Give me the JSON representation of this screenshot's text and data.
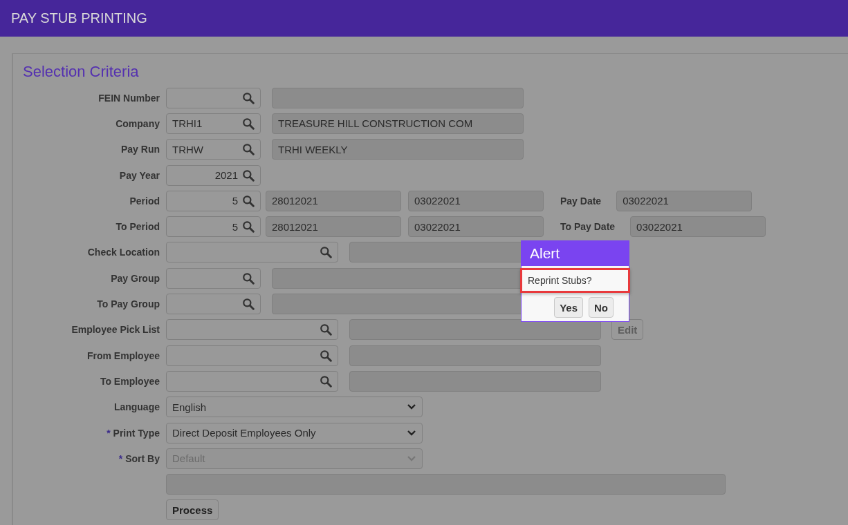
{
  "header": {
    "title": "PAY STUB PRINTING"
  },
  "section_title": "Selection Criteria",
  "rows": [
    {
      "kind": "lookup",
      "label": "FEIN Number"
    },
    {
      "kind": "lookup",
      "label": "Company",
      "value": "TRHI1",
      "description": "TREASURE HILL CONSTRUCTION COM"
    },
    {
      "kind": "lookup",
      "label": "Pay Run",
      "value": "TRHW",
      "description": "TRHI WEEKLY"
    },
    {
      "kind": "year",
      "label": "Pay Year",
      "value": "2021"
    },
    {
      "kind": "period",
      "label": "Period",
      "value": "5",
      "start": "28012021",
      "end": "03022021",
      "date_label": "Pay Date",
      "date": "03022021"
    },
    {
      "kind": "period",
      "label": "To Period",
      "value": "5",
      "start": "28012021",
      "end": "03022021",
      "date_label": "To Pay Date",
      "date": "03022021"
    },
    {
      "kind": "wide-lookup",
      "label": "Check Location"
    },
    {
      "kind": "lookup",
      "label": "Pay Group"
    },
    {
      "kind": "lookup",
      "label": "To Pay Group"
    },
    {
      "kind": "wide-lookup",
      "label": "Employee Pick List",
      "button": {
        "label": "Edit",
        "disabled": true
      }
    },
    {
      "kind": "wide-lookup",
      "label": "From Employee"
    },
    {
      "kind": "wide-lookup",
      "label": "To Employee"
    },
    {
      "kind": "select",
      "label": "Language",
      "value": "English",
      "disabled": false
    },
    {
      "kind": "select",
      "label": "Print Type",
      "required_mark": "*",
      "value": "Direct Deposit Employees Only",
      "disabled": false
    },
    {
      "kind": "select",
      "label": "Sort By",
      "required_mark": "*",
      "value": "Default",
      "disabled": true
    },
    {
      "kind": "blank"
    },
    {
      "kind": "button",
      "label": "Process"
    }
  ],
  "dialog": {
    "title": "Alert",
    "message": "Reprint Stubs?",
    "highlighted": true,
    "buttons": [
      "Yes",
      "No"
    ]
  }
}
